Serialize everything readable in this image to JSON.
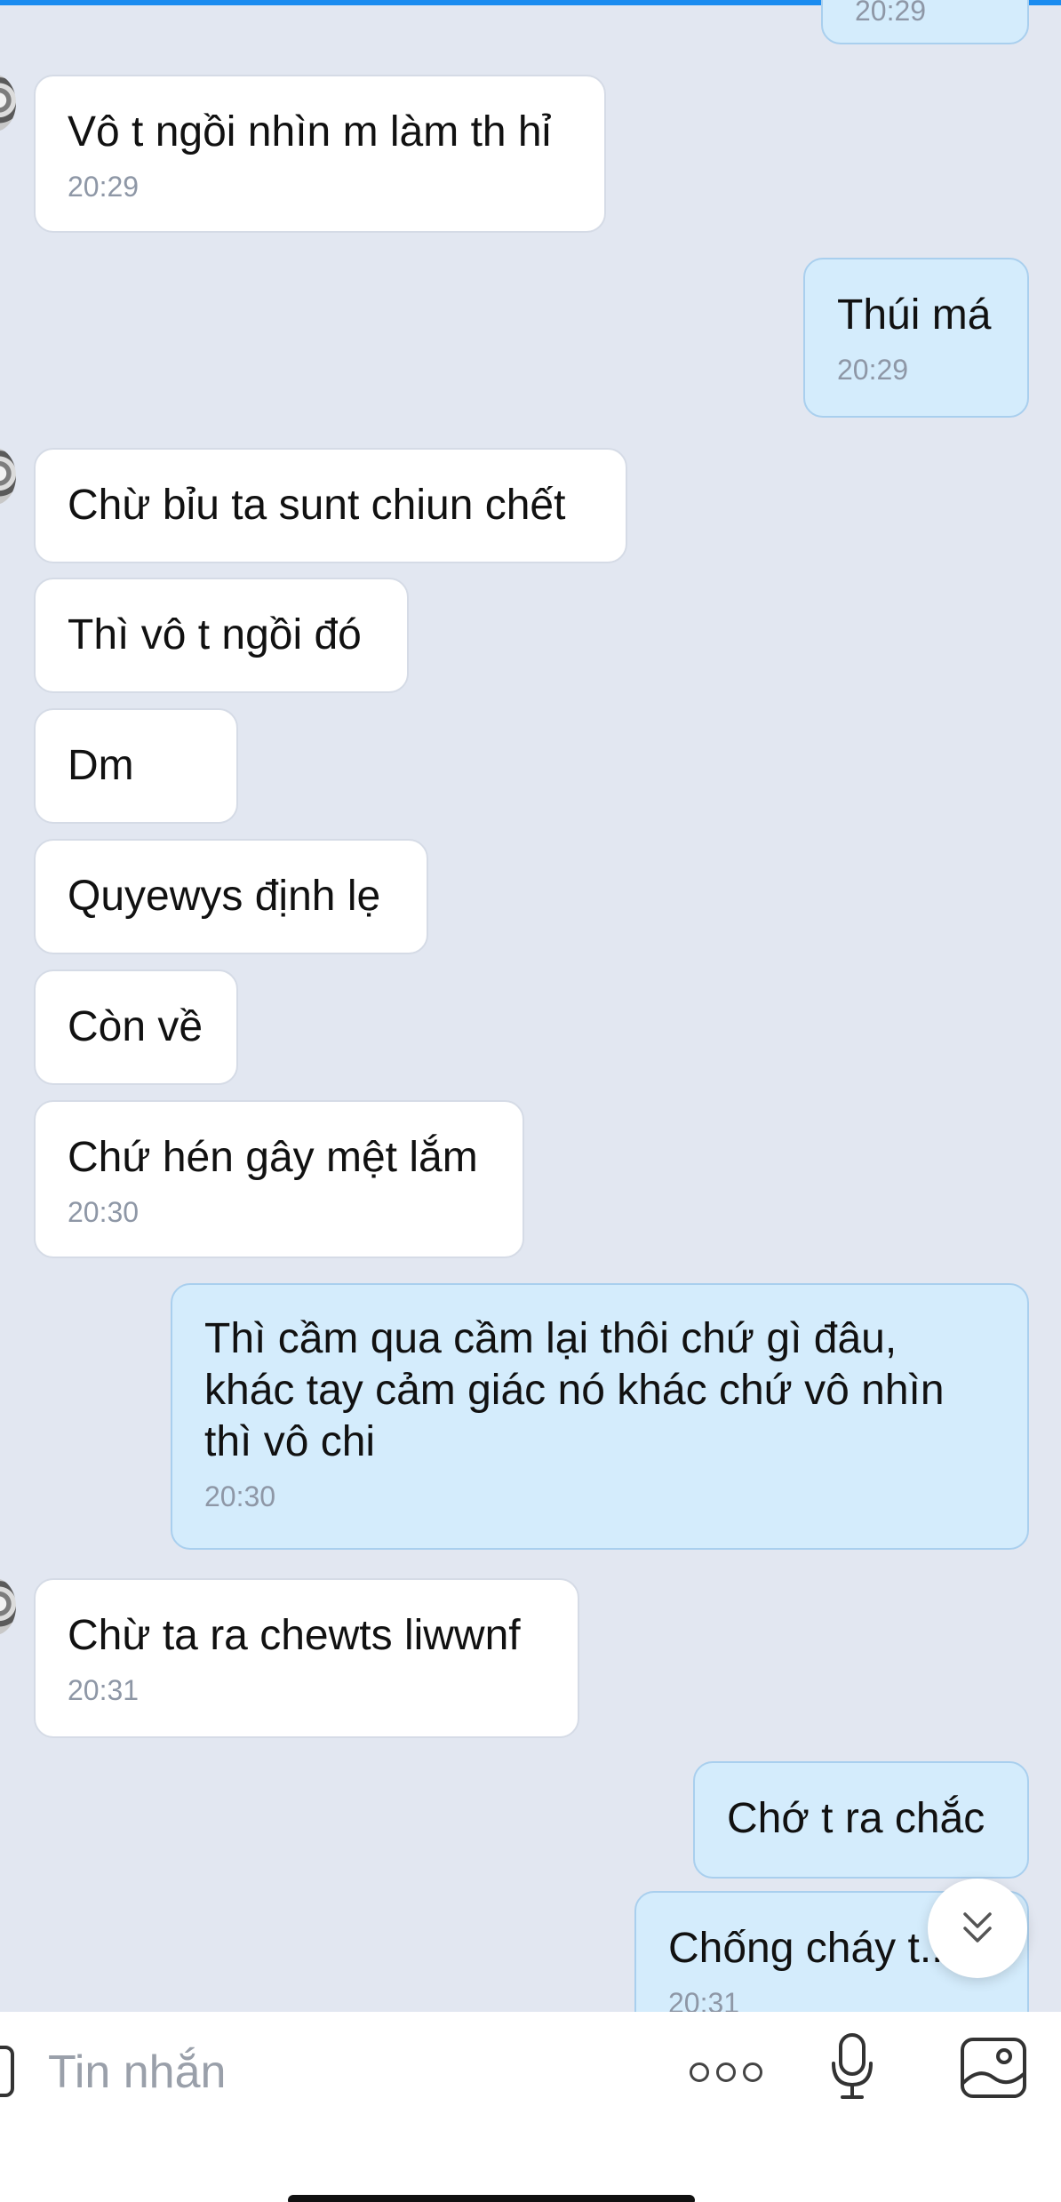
{
  "messages": [
    {
      "side": "out",
      "text": "",
      "time": "20:29"
    },
    {
      "side": "in",
      "text": "Vô t ngồi nhìn m làm th hỉ",
      "time": "20:29"
    },
    {
      "side": "out",
      "text": "Thúi má",
      "time": "20:29"
    },
    {
      "side": "in",
      "text": "Chừ bỉu ta sunt chiun chết",
      "time": ""
    },
    {
      "side": "in",
      "text": "Thì vô t ngồi đó",
      "time": ""
    },
    {
      "side": "in",
      "text": "Dm",
      "time": ""
    },
    {
      "side": "in",
      "text": "Quyewys định lẹ",
      "time": ""
    },
    {
      "side": "in",
      "text": "Còn về",
      "time": ""
    },
    {
      "side": "in",
      "text": "Chứ hén gây mệt lắm",
      "time": "20:30"
    },
    {
      "side": "out",
      "text": "Thì cầm qua cầm lại thôi chứ gì đâu, khác tay cảm giác nó khác chứ vô nhìn thì vô chi",
      "time": "20:30"
    },
    {
      "side": "in",
      "text": "Chừ ta ra chewts liwwnf",
      "time": "20:31"
    },
    {
      "side": "out",
      "text": "Chớ t ra chắc",
      "time": ""
    },
    {
      "side": "out",
      "text": "Chống cháy t...",
      "time": "20:31"
    }
  ],
  "input": {
    "placeholder": "Tin nhắn"
  },
  "icons": {
    "more": "more-options-icon",
    "mic": "microphone-icon",
    "photo": "image-icon",
    "scroll": "scroll-down-icon"
  },
  "colors": {
    "background": "#e2e7f1",
    "incoming_bubble": "#ffffff",
    "outgoing_bubble": "#d4ecfc",
    "accent": "#1a8cf0"
  }
}
